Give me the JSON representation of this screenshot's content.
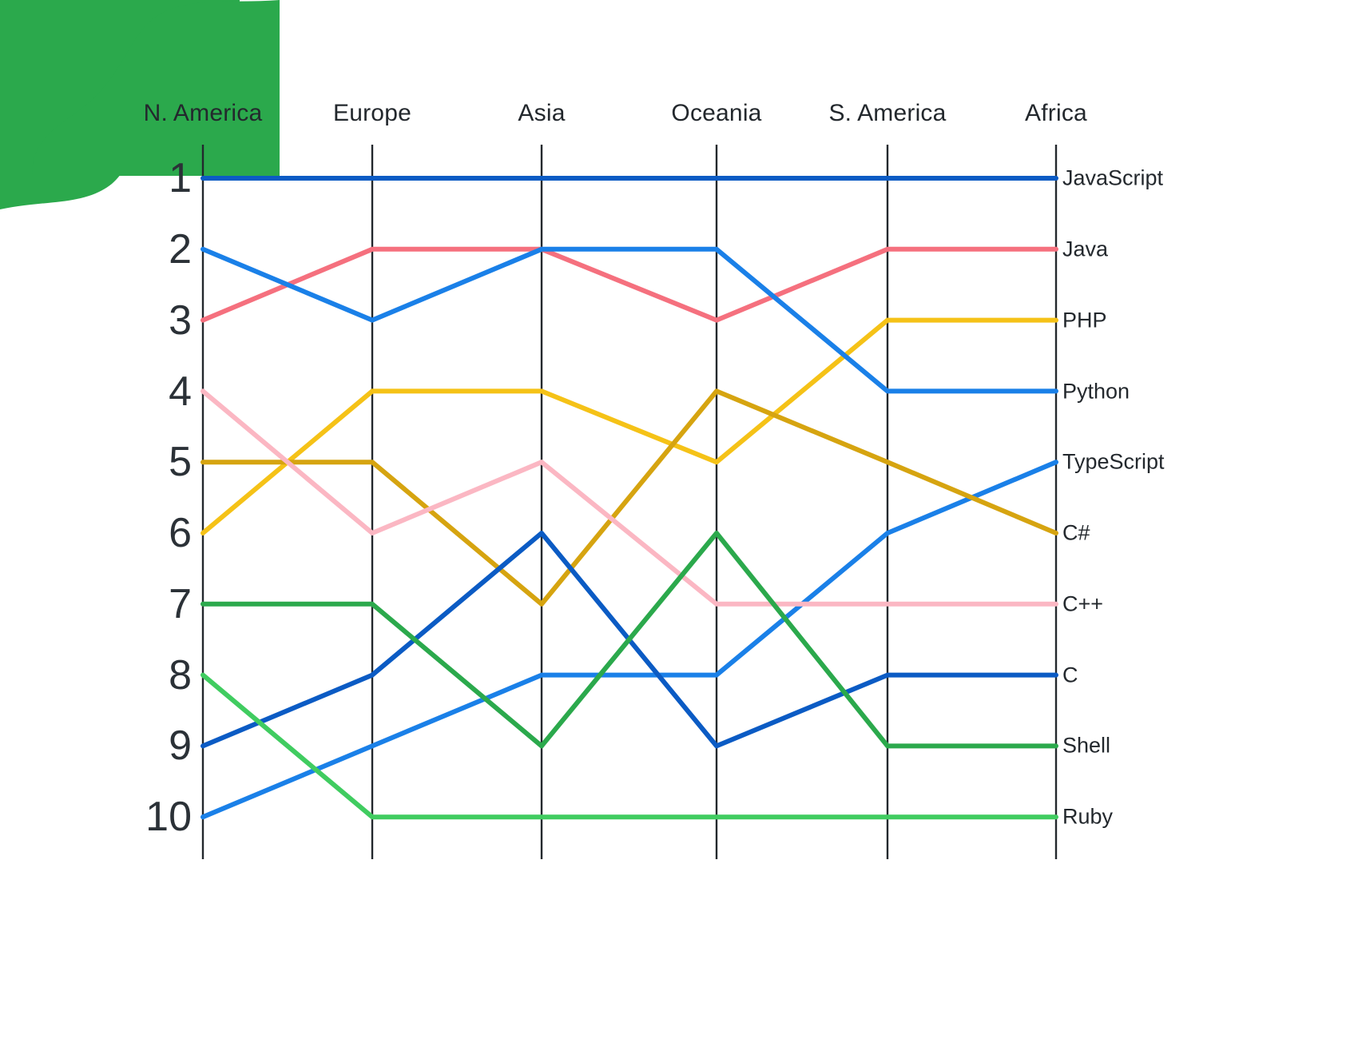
{
  "decor": {
    "corner_color": "#2BA94C",
    "top_left_shape": "blob-wave",
    "bottom_right_shape": "blob-wave"
  },
  "chart_data": {
    "type": "line",
    "subtype": "parallel-coordinates-bump-chart",
    "title": "",
    "xlabel": "",
    "ylabel": "",
    "grid": false,
    "legend_position": "right-inline-labels",
    "categories": [
      "N. America",
      "Europe",
      "Asia",
      "Oceania",
      "S. America",
      "Africa"
    ],
    "rank_ticks": [
      "1",
      "2",
      "3",
      "4",
      "5",
      "6",
      "7",
      "8",
      "9",
      "10"
    ],
    "ylim": [
      1,
      10
    ],
    "y_inverted": true,
    "series": [
      {
        "name": "JavaScript",
        "color": "#0B5BC4",
        "values": [
          1,
          1,
          1,
          1,
          1,
          1
        ]
      },
      {
        "name": "Java",
        "color": "#F5707E",
        "values": [
          3,
          2,
          2,
          3,
          2,
          2
        ]
      },
      {
        "name": "PHP",
        "color": "#F5C217",
        "values": [
          6,
          4,
          4,
          5,
          3,
          3
        ]
      },
      {
        "name": "Python",
        "color": "#1A80E8",
        "values": [
          2,
          3,
          2,
          2,
          4,
          4
        ]
      },
      {
        "name": "TypeScript",
        "color": "#1A80E8",
        "values": [
          10,
          9,
          8,
          8,
          6,
          5
        ]
      },
      {
        "name": "C#",
        "color": "#D6A410",
        "values": [
          5,
          5,
          7,
          4,
          5,
          6
        ]
      },
      {
        "name": "C++",
        "color": "#FBB7C3",
        "values": [
          4,
          6,
          5,
          7,
          7,
          7
        ]
      },
      {
        "name": "C",
        "color": "#0B5BC4",
        "values": [
          9,
          8,
          6,
          9,
          8,
          8
        ]
      },
      {
        "name": "Shell",
        "color": "#2BA94C",
        "values": [
          7,
          7,
          9,
          6,
          9,
          9
        ]
      },
      {
        "name": "Ruby",
        "color": "#40CC60",
        "values": [
          8,
          10,
          10,
          10,
          10,
          10
        ]
      }
    ]
  },
  "axis_style": {
    "line_color": "#23282d",
    "tick_color": "#2b3137"
  }
}
